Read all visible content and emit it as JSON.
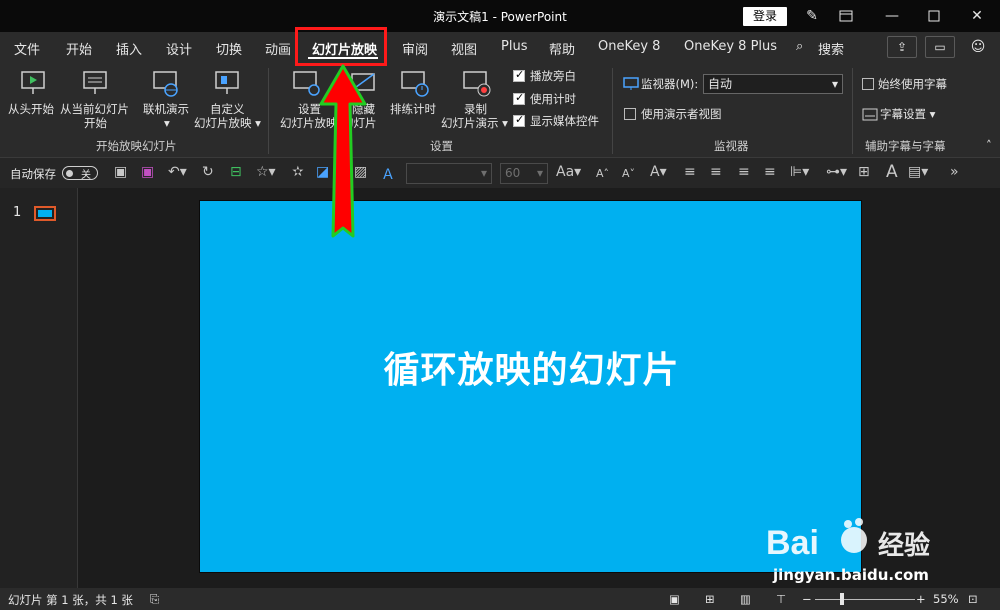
{
  "window": {
    "title": "演示文稿1  -  PowerPoint",
    "login_label": "登录"
  },
  "tabs": [
    {
      "label": "文件"
    },
    {
      "label": "开始"
    },
    {
      "label": "插入"
    },
    {
      "label": "设计"
    },
    {
      "label": "切换"
    },
    {
      "label": "动画"
    },
    {
      "label": "幻灯片放映"
    },
    {
      "label": "审阅"
    },
    {
      "label": "视图"
    },
    {
      "label": "Plus"
    },
    {
      "label": "帮助"
    },
    {
      "label": "OneKey 8"
    },
    {
      "label": "OneKey 8 Plus"
    },
    {
      "label": "搜索"
    }
  ],
  "active_tab": "幻灯片放映",
  "ribbon": {
    "start_group": {
      "from_beginning": "从头开始",
      "from_current_line1": "从当前幻灯片",
      "from_current_line2": "开始",
      "online_present": "联机演示",
      "custom_line1": "自定义",
      "custom_line2": "幻灯片放映 ▾",
      "group_label": "开始放映幻灯片"
    },
    "setup_group": {
      "setup_line1": "设置",
      "setup_line2": "幻灯片放映",
      "hide_line1": "隐藏",
      "hide_line2": "幻灯片",
      "rehearse": "排练计时",
      "record_line1": "录制",
      "record_line2": "幻灯片演示 ▾",
      "play_narrations": "播放旁白",
      "use_timings": "使用计时",
      "show_media_controls": "显示媒体控件",
      "group_label": "设置"
    },
    "monitor_group": {
      "monitor_label": "监视器(M):",
      "monitor_value": "自动",
      "presenter_view": "使用演示者视图",
      "group_label": "监视器"
    },
    "captions_group": {
      "always_subtitles": "始终使用字幕",
      "subtitle_settings": "字幕设置 ▾",
      "group_label": "辅助字幕与字幕"
    }
  },
  "toolbar": {
    "autosave_label": "自动保存",
    "autosave_state": "关",
    "font_size": "60"
  },
  "slides_panel": {
    "slide_number": "1"
  },
  "slide": {
    "title": "循环放映的幻灯片",
    "background_color": "#00b0f0"
  },
  "status": {
    "slide_info": "幻灯片 第 1 张，共 1 张",
    "zoom": "55%"
  },
  "watermark": {
    "brand": "Bai 经验",
    "url": "jingyan.baidu.com"
  },
  "colors": {
    "highlight_box": "#ff1a1a",
    "arrow_fill": "#ff0000",
    "arrow_outline": "#22cc22"
  }
}
